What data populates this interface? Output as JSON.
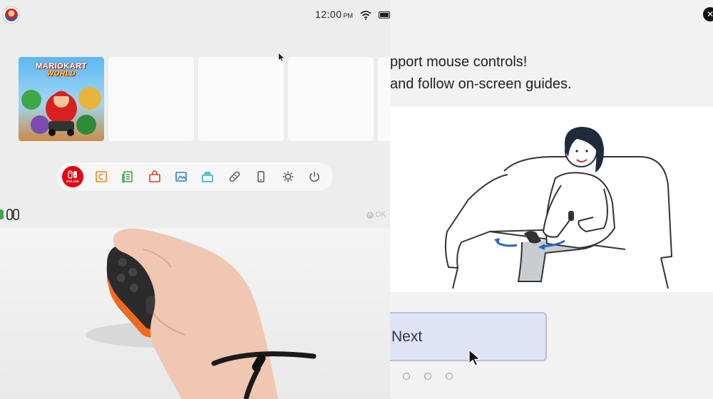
{
  "statusbar": {
    "time": "12:00",
    "ampm": "PM"
  },
  "home": {
    "tiles": [
      {
        "kind": "game",
        "title_line1": "MARIOKART",
        "title_line2": "WORLD"
      },
      {
        "kind": "empty"
      },
      {
        "kind": "empty"
      },
      {
        "kind": "empty"
      },
      {
        "kind": "empty"
      }
    ],
    "dock": {
      "online_label": "ONLINE",
      "icons": [
        "news-icon",
        "eshop-icon",
        "album-icon",
        "controllers-icon",
        "system-settings-icon",
        "power-icon"
      ]
    },
    "ok_hint": {
      "button": "A",
      "label": "OK"
    }
  },
  "tutorial": {
    "line1": "pport mouse controls!",
    "line2": "and follow on-screen guides.",
    "next_label": "Next",
    "pages": 3
  },
  "colors": {
    "online_red": "#e60012",
    "next_button_bg": "#dfe3f5",
    "arrow_blue": "#2a66c8",
    "controller_orange": "#f26b1d"
  }
}
